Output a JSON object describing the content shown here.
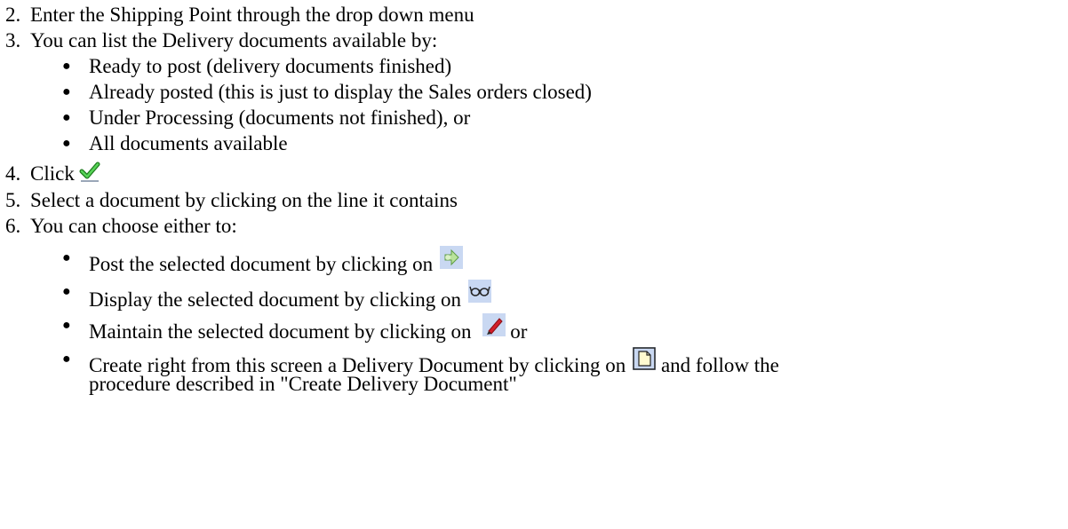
{
  "steps": [
    {
      "number": "2.",
      "text": "Enter the Shipping Point through the drop down menu"
    },
    {
      "number": "3.",
      "text": "You can list the Delivery documents available by:"
    },
    {
      "number": "4.",
      "text": "Click"
    },
    {
      "number": "5.",
      "text": "Select a document by clicking on the line it contains"
    },
    {
      "number": "6.",
      "text": "You can choose either to:"
    }
  ],
  "step3_bullets": [
    "Ready to post (delivery documents finished)",
    "Already posted (this is just to display the Sales orders closed)",
    "Under Processing (documents not finished), or",
    "All documents available"
  ],
  "step6_bullets": {
    "post": {
      "text": "Post the selected document by clicking on",
      "icon": "post-arrow-icon"
    },
    "display": {
      "text": "Display the selected document by clicking on",
      "icon": "display-glasses-icon"
    },
    "maintain": {
      "text": "Maintain the selected document by clicking on",
      "icon": "maintain-pencil-icon",
      "suffix": "or"
    },
    "create": {
      "text": "Create right from this screen a Delivery Document by clicking on",
      "icon": "create-document-icon",
      "suffix": "and follow the",
      "line2": "procedure described in \"Create Delivery Document\""
    }
  },
  "icons": {
    "step4": "checkmark-icon",
    "check_color": "#2fa52f",
    "button_bg": "#c9d8f2"
  }
}
